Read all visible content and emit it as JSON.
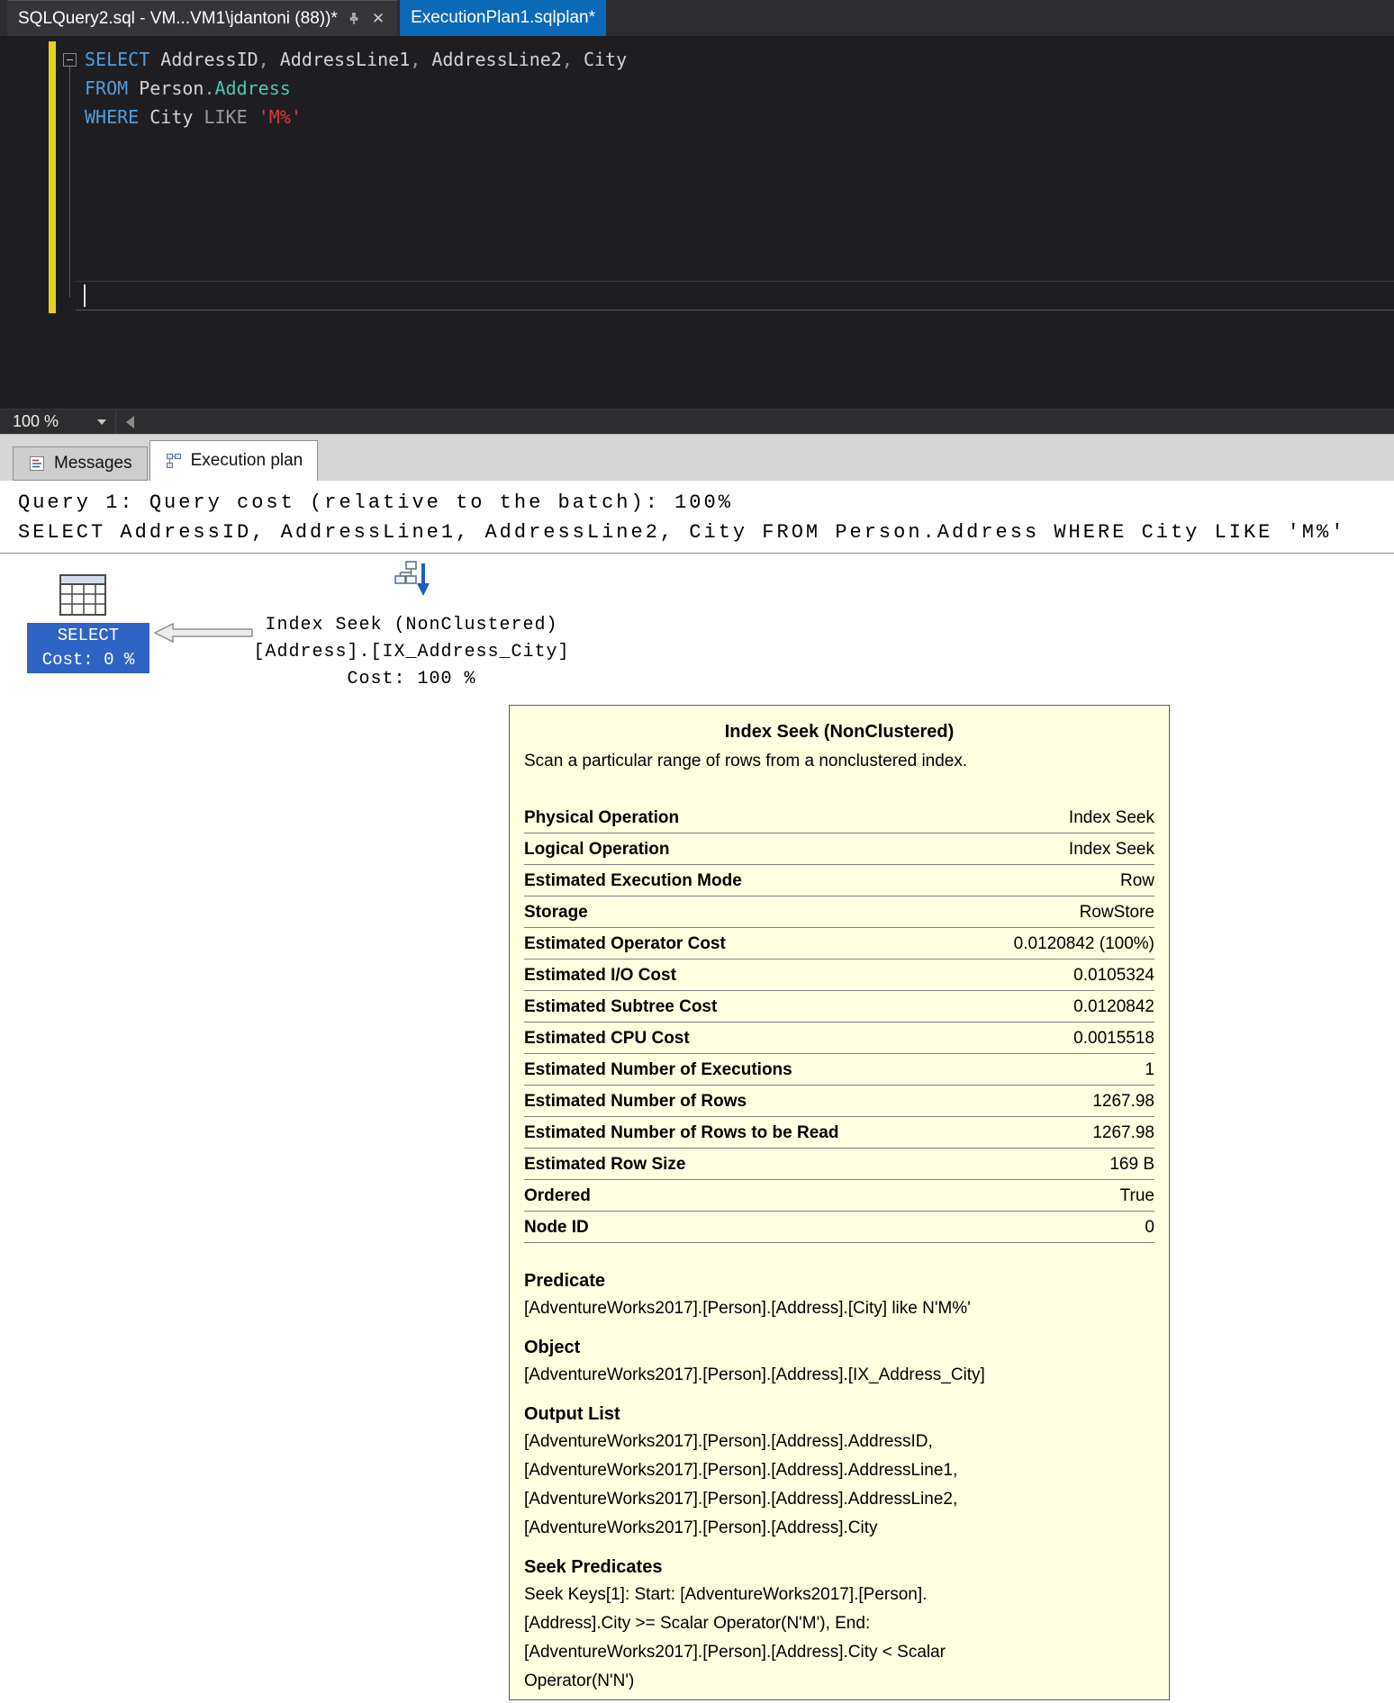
{
  "window": {
    "tabs": [
      {
        "label": "SQLQuery2.sql - VM...VM1\\jdantoni (88))*"
      },
      {
        "label": "ExecutionPlan1.sqlplan*"
      }
    ]
  },
  "icons": {
    "close": "✕"
  },
  "editor": {
    "zoom_level": "100 %",
    "lines": [
      [
        {
          "t": "SELECT",
          "c": "kw"
        },
        {
          "t": " AddressID",
          "c": "pl"
        },
        {
          "t": ",",
          "c": "gy"
        },
        {
          "t": " AddressLine1",
          "c": "pl"
        },
        {
          "t": ",",
          "c": "gy"
        },
        {
          "t": " AddressLine2",
          "c": "pl"
        },
        {
          "t": ",",
          "c": "gy"
        },
        {
          "t": " City",
          "c": "pl"
        }
      ],
      [
        {
          "t": "FROM",
          "c": "kw"
        },
        {
          "t": " Person",
          "c": "pl"
        },
        {
          "t": ".",
          "c": "gy"
        },
        {
          "t": "Address",
          "c": "tb"
        }
      ],
      [
        {
          "t": "WHERE",
          "c": "kw"
        },
        {
          "t": " City",
          "c": "pl"
        },
        {
          "t": " LIKE",
          "c": "gy"
        },
        {
          "t": " ",
          "c": "pl"
        },
        {
          "t": "'M%'",
          "c": "st"
        }
      ]
    ]
  },
  "results": {
    "tabs": [
      {
        "label": "Messages"
      },
      {
        "label": "Execution plan",
        "selected": true
      }
    ]
  },
  "plan": {
    "header_line1": "Query 1: Query cost (relative to the batch): 100%",
    "header_line2": "SELECT AddressID, AddressLine1, AddressLine2, City FROM Person.Address WHERE City LIKE 'M%'",
    "select_node": {
      "line1": "SELECT",
      "line2": "Cost: 0 %"
    },
    "seek_node": {
      "line1": "Index Seek (NonClustered)",
      "line2": "[Address].[IX_Address_City]",
      "line3": "Cost: 100 %"
    }
  },
  "tooltip": {
    "title": "Index Seek (NonClustered)",
    "description": "Scan a particular range of rows from a nonclustered index.",
    "rows": [
      {
        "label": "Physical Operation",
        "value": "Index Seek"
      },
      {
        "label": "Logical Operation",
        "value": "Index Seek"
      },
      {
        "label": "Estimated Execution Mode",
        "value": "Row"
      },
      {
        "label": "Storage",
        "value": "RowStore"
      },
      {
        "label": "Estimated Operator Cost",
        "value": "0.0120842 (100%)"
      },
      {
        "label": "Estimated I/O Cost",
        "value": "0.0105324"
      },
      {
        "label": "Estimated Subtree Cost",
        "value": "0.0120842"
      },
      {
        "label": "Estimated CPU Cost",
        "value": "0.0015518"
      },
      {
        "label": "Estimated Number of Executions",
        "value": "1"
      },
      {
        "label": "Estimated Number of Rows",
        "value": "1267.98"
      },
      {
        "label": "Estimated Number of Rows to be Read",
        "value": "1267.98"
      },
      {
        "label": "Estimated Row Size",
        "value": "169 B"
      },
      {
        "label": "Ordered",
        "value": "True"
      },
      {
        "label": "Node ID",
        "value": "0"
      }
    ],
    "sections": [
      {
        "title": "Predicate",
        "lines": [
          "[AdventureWorks2017].[Person].[Address].[City] like N'M%'"
        ]
      },
      {
        "title": "Object",
        "lines": [
          "[AdventureWorks2017].[Person].[Address].[IX_Address_City]"
        ]
      },
      {
        "title": "Output List",
        "lines": [
          "[AdventureWorks2017].[Person].[Address].AddressID,",
          "[AdventureWorks2017].[Person].[Address].AddressLine1,",
          "[AdventureWorks2017].[Person].[Address].AddressLine2,",
          "[AdventureWorks2017].[Person].[Address].City"
        ]
      },
      {
        "title": "Seek Predicates",
        "lines": [
          "Seek Keys[1]: Start: [AdventureWorks2017].[Person].",
          "[Address].City >= Scalar Operator(N'M'), End:",
          "[AdventureWorks2017].[Person].[Address].City < Scalar",
          "Operator(N'N')"
        ]
      }
    ]
  },
  "colors": {
    "keyword_blue": "#569cd6",
    "string_red": "#d83a3a",
    "table_teal": "#4ec9b0",
    "selected_node_blue": "#2f63c5",
    "active_tab_blue": "#0c69b8",
    "tooltip_bg": "#ffffe1",
    "change_bar_yellow": "#e6d21f"
  }
}
